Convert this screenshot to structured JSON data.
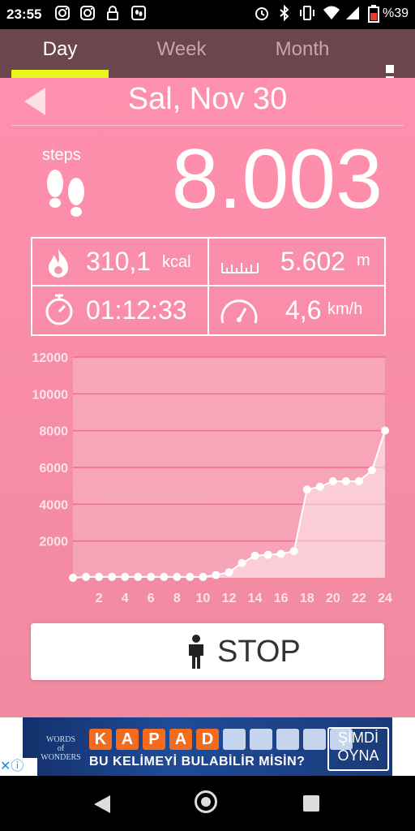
{
  "status_bar": {
    "time": "23:55",
    "battery": "%39",
    "left_icons": [
      "instagram-icon",
      "instagram-icon",
      "lock-icon",
      "footprint-app-icon"
    ],
    "right_icons": [
      "alarm-icon",
      "bluetooth-icon",
      "vibrate-icon",
      "wifi-icon",
      "signal-icon",
      "battery-icon"
    ]
  },
  "tabs": [
    {
      "label": "Day",
      "active": true
    },
    {
      "label": "Week",
      "active": false
    },
    {
      "label": "Month",
      "active": false
    }
  ],
  "date": "Sal, Nov 30",
  "steps": {
    "label": "steps",
    "value": "8.003"
  },
  "stats": {
    "calories": {
      "value": "310,1",
      "unit": "kcal"
    },
    "distance": {
      "value": "5.602",
      "unit": "m"
    },
    "duration": {
      "value": "01:12:33"
    },
    "speed": {
      "value": "4,6",
      "unit": "km/h"
    }
  },
  "chart_data": {
    "type": "area",
    "title": "",
    "xlabel": "",
    "ylabel": "",
    "ylim": [
      0,
      12000
    ],
    "xlim": [
      0,
      24
    ],
    "yticks": [
      2000,
      4000,
      6000,
      8000,
      10000,
      12000
    ],
    "ytick_labels": [
      "2000",
      "4000",
      "6000",
      "8000",
      "10000",
      "12000"
    ],
    "xticks": [
      2,
      4,
      6,
      8,
      10,
      12,
      14,
      16,
      18,
      20,
      22,
      24
    ],
    "xtick_labels": [
      "2",
      "4",
      "6",
      "8",
      "10",
      "12",
      "14",
      "16",
      "18",
      "20",
      "22",
      "24"
    ],
    "grid": true,
    "series": [
      {
        "x": [
          0,
          1,
          2,
          3,
          4,
          5,
          6,
          7,
          8,
          9,
          10,
          11,
          12,
          13,
          14,
          15,
          16,
          17,
          18,
          19,
          20,
          21,
          22,
          23,
          24
        ],
        "values": [
          0,
          50,
          50,
          50,
          50,
          50,
          50,
          50,
          50,
          50,
          50,
          150,
          300,
          800,
          1200,
          1250,
          1300,
          1450,
          4800,
          4950,
          5250,
          5250,
          5250,
          5850,
          8003
        ]
      }
    ]
  },
  "stop_button": {
    "label": "STOP"
  },
  "ad": {
    "logo_line1": "WORDS",
    "logo_line2": "of",
    "logo_line3": "WONDERS",
    "tiles": [
      "K",
      "A",
      "P",
      "A",
      "D",
      "",
      "",
      "",
      "",
      ""
    ],
    "question": "BU KELİMEYİ BULABİLİR MİSİN?",
    "cta_line1": "ŞİMDİ",
    "cta_line2": "OYNA",
    "close_glyph": "✕ⓘ"
  }
}
